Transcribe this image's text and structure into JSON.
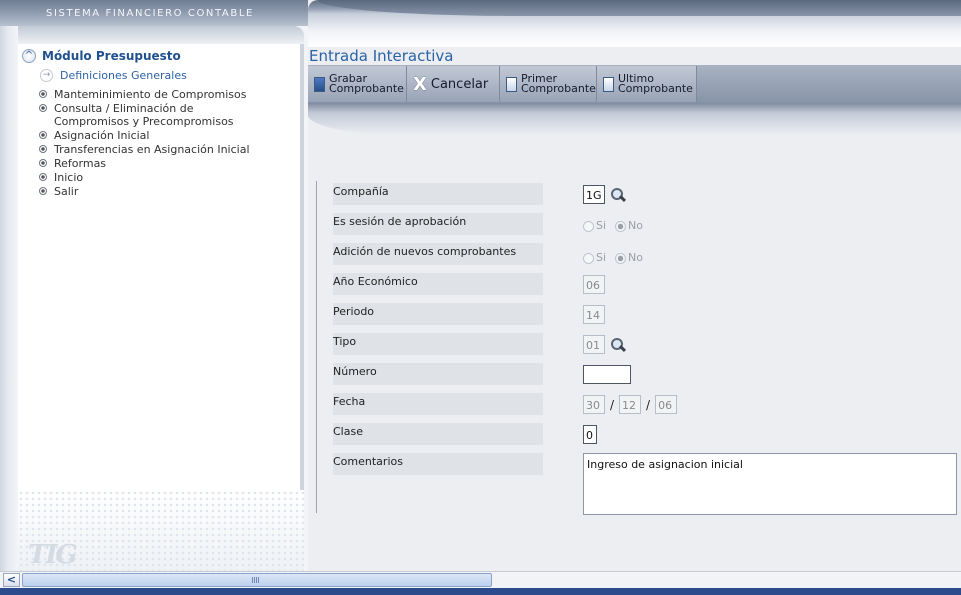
{
  "app": {
    "banner_title": "SISTEMA FINANCIERO CONTABLE",
    "logo_text": "TIG"
  },
  "sidebar": {
    "module_title": "Módulo Presupuesto",
    "definitions_label": "Definiciones Generales",
    "items": [
      {
        "label": "Manteminimiento de Compromisos"
      },
      {
        "label": "Consulta / Eliminación de Compromisos y Precompromisos"
      },
      {
        "label": "Asignación Inicial"
      },
      {
        "label": "Transferencias en Asignación Inicial"
      },
      {
        "label": "Reformas"
      },
      {
        "label": "Inicio"
      },
      {
        "label": "Salir"
      }
    ]
  },
  "main": {
    "heading": "Entrada Interactiva",
    "toolbar": {
      "save": "Grabar\nComprobante",
      "cancel": "Cancelar",
      "first": "Primer\nComprobante",
      "last": "Ultimo\nComprobante"
    },
    "form": {
      "company": {
        "label": "Compañía",
        "value": "1G"
      },
      "approval_session": {
        "label": "Es sesión de aprobación",
        "options": [
          "Si",
          "No"
        ],
        "selected": "No"
      },
      "new_vouchers": {
        "label": "Adición de nuevos comprobantes",
        "options": [
          "Si",
          "No"
        ],
        "selected": "No"
      },
      "fiscal_year": {
        "label": "Año Económico",
        "value": "06"
      },
      "period": {
        "label": "Periodo",
        "value": "14"
      },
      "type": {
        "label": "Tipo",
        "value": "01"
      },
      "number": {
        "label": "Número",
        "value": ""
      },
      "date": {
        "label": "Fecha",
        "day": "30",
        "month": "12",
        "year": "06",
        "separator": "/"
      },
      "class": {
        "label": "Clase",
        "value": "0"
      },
      "comments": {
        "label": "Comentarios",
        "value": "Ingreso de asignacion inicial"
      }
    }
  },
  "scrollbar": {
    "left_arrow": "<",
    "thumb_grip": "|||"
  }
}
